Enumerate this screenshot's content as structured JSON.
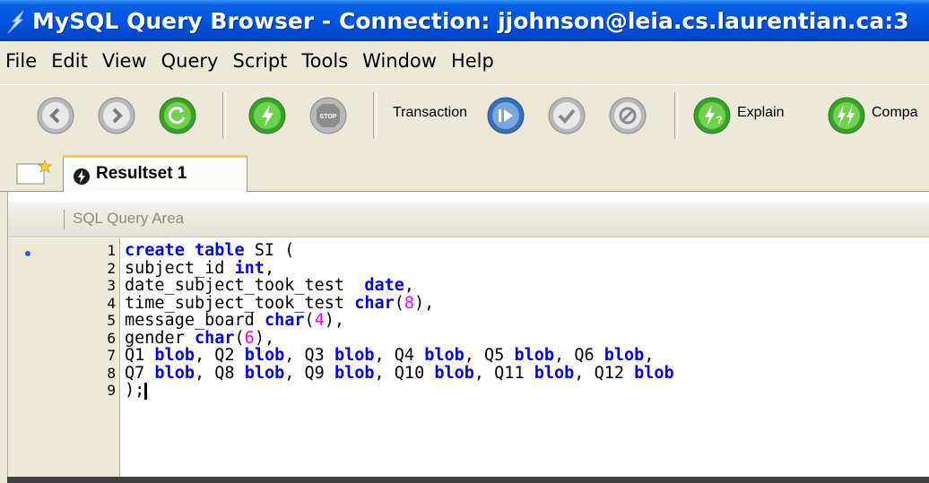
{
  "window": {
    "title": "MySQL Query Browser - Connection: jjohnson@leia.cs.laurentian.ca:3"
  },
  "menu": [
    "File",
    "Edit",
    "View",
    "Query",
    "Script",
    "Tools",
    "Window",
    "Help"
  ],
  "toolbar": {
    "transaction_label": "Transaction",
    "explain_label": "Explain",
    "compare_label": "Compa",
    "stop_label": "STOP"
  },
  "tabs": [
    {
      "label": "Resultset 1"
    }
  ],
  "sql_area": {
    "header": "SQL Query Area",
    "line_numbers": [
      "1",
      "2",
      "3",
      "4",
      "5",
      "6",
      "7",
      "8",
      "9"
    ]
  },
  "code": {
    "l1": [
      "create table",
      " SI ("
    ],
    "l2": [
      "subject_id ",
      "int",
      ","
    ],
    "l3": [
      "date_subject_took_test  ",
      "date",
      ","
    ],
    "l4": [
      "time_subject_took_test ",
      "char",
      "(",
      "8",
      "),"
    ],
    "l5": [
      "message_board ",
      "char",
      "(",
      "4",
      "),"
    ],
    "l6": [
      "gender ",
      "char",
      "(",
      "6",
      "),"
    ],
    "l7": [
      "Q1 ",
      "blob",
      ", Q2 ",
      "blob",
      ", Q3 ",
      "blob",
      ", Q4 ",
      "blob",
      ", Q5 ",
      "blob",
      ", Q6 ",
      "blob",
      ","
    ],
    "l8": [
      "Q7 ",
      "blob",
      ", Q8 ",
      "blob",
      ", Q9 ",
      "blob",
      ", Q10 ",
      "blob",
      ", Q11 ",
      "blob",
      ", Q12 ",
      "blob"
    ],
    "l9": [
      ");"
    ]
  },
  "colors": {
    "titlebar": "#0054e3",
    "keyword": "#0000ff",
    "number": "#ff00ff",
    "tab_highlight": "#ffc83c"
  }
}
